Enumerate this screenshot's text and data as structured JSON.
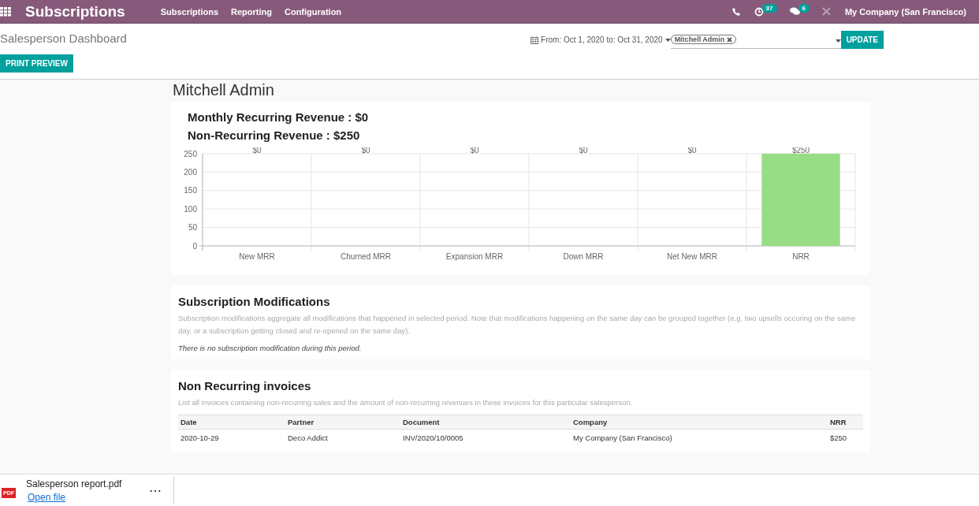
{
  "navbar": {
    "app_title": "Subscriptions",
    "menu": [
      "Subscriptions",
      "Reporting",
      "Configuration"
    ],
    "activity_count": "37",
    "message_count": "6",
    "company": "My Company (San Francisco)"
  },
  "control_panel": {
    "breadcrumb": "Salesperson Dashboard",
    "print_button": "PRINT PREVIEW",
    "date_range": "From: Oct 1, 2020 to: Oct 31, 2020",
    "salesperson_tag": "Mitchell Admin",
    "update_button": "UPDATE"
  },
  "salesperson_name": "Mitchell Admin",
  "revenue": {
    "mrr": "Monthly Recurring Revenue : $0",
    "nrr": "Non-Recurring Revenue : $250",
    "chart_data": {
      "type": "bar",
      "categories": [
        "New MRR",
        "Churned MRR",
        "Expansion MRR",
        "Down MRR",
        "Net New MRR",
        "NRR"
      ],
      "series": [
        {
          "color": "#96dd86",
          "values": [
            0,
            0,
            0,
            0,
            0,
            250
          ]
        }
      ],
      "ylim": [
        0,
        250
      ],
      "yticks": [
        0,
        50,
        100,
        150,
        200,
        250
      ],
      "grid": true,
      "value_labels": [
        "$0",
        "$0",
        "$0",
        "$0",
        "$0",
        "$250"
      ]
    }
  },
  "modifications": {
    "title": "Subscription Modifications",
    "description": "Subscription modifications aggregate all modifications that happened in selected period. Note that modifications happening on the same day can be grouped together (e.g. two upsells occuring on the same day, or a subscription getting closed and re-opened on the same day).",
    "empty_note": "There is no subscription modification during this period."
  },
  "invoices": {
    "title": "Non Recurring invoices",
    "description": "List all invoices containing non-recurring sales and the amount of non-recurring revenues in these invoices for this particular salesperson.",
    "columns": [
      "Date",
      "Partner",
      "Document",
      "Company",
      "NRR"
    ],
    "rows": [
      [
        "2020-10-29",
        "Deco Addict",
        "INV/2020/10/0005",
        "My Company (San Francisco)",
        "$250"
      ]
    ]
  },
  "download": {
    "icon_label": "PDF",
    "file_name": "Salesperson report.pdf",
    "open_link": "Open file",
    "more": "⋯"
  }
}
